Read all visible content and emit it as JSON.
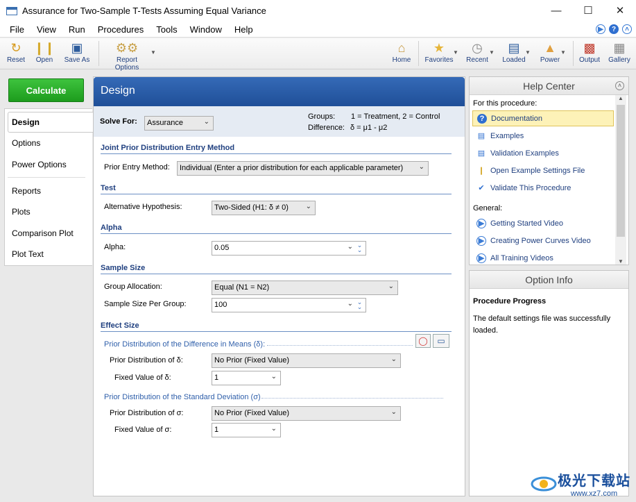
{
  "window": {
    "title": "Assurance for Two-Sample T-Tests Assuming Equal Variance"
  },
  "menu": [
    "File",
    "View",
    "Run",
    "Procedures",
    "Tools",
    "Window",
    "Help"
  ],
  "toolbar": {
    "reset": "Reset",
    "open": "Open",
    "save_as": "Save As",
    "report_options": "Report Options",
    "home": "Home",
    "favorites": "Favorites",
    "recent": "Recent",
    "loaded": "Loaded",
    "power": "Power",
    "output": "Output",
    "gallery": "Gallery"
  },
  "calculate": "Calculate",
  "tabs": [
    "Design",
    "Options",
    "Power Options",
    "Reports",
    "Plots",
    "Comparison Plot",
    "Plot Text"
  ],
  "design": {
    "header": "Design",
    "solve_for_label": "Solve For:",
    "solve_for_value": "Assurance",
    "groups_label": "Groups:",
    "groups_value": "1 = Treatment, 2 = Control",
    "difference_label": "Difference:",
    "difference_value": "δ = μ1 - μ2",
    "sec_joint": "Joint Prior Distribution Entry Method",
    "prior_entry_label": "Prior Entry Method:",
    "prior_entry_value": "Individual (Enter a prior distribution for each applicable parameter)",
    "sec_test": "Test",
    "alt_hyp_label": "Alternative Hypothesis:",
    "alt_hyp_value": "Two-Sided (H1: δ ≠ 0)",
    "sec_alpha": "Alpha",
    "alpha_label": "Alpha:",
    "alpha_value": "0.05",
    "sec_sample": "Sample Size",
    "group_alloc_label": "Group Allocation:",
    "group_alloc_value": "Equal (N1 = N2)",
    "ss_per_group_label": "Sample Size Per Group:",
    "ss_per_group_value": "100",
    "sec_effect": "Effect Size",
    "prior_diff_heading": "Prior Distribution of the Difference in Means (δ):",
    "prior_delta_label": "Prior Distribution of δ:",
    "prior_delta_value": "No Prior (Fixed Value)",
    "fixed_delta_label": "Fixed Value of δ:",
    "fixed_delta_value": "1",
    "prior_sd_heading": "Prior Distribution of the Standard Deviation (σ)",
    "prior_sigma_label": "Prior Distribution of σ:",
    "prior_sigma_value": "No Prior (Fixed Value)",
    "fixed_sigma_label": "Fixed Value of σ:",
    "fixed_sigma_value": "1"
  },
  "help_center": {
    "title": "Help Center",
    "for_this": "For this procedure:",
    "items": [
      "Documentation",
      "Examples",
      "Validation Examples",
      "Open Example Settings File",
      "Validate This Procedure"
    ],
    "general": "General:",
    "general_items": [
      "Getting Started Video",
      "Creating Power Curves Video",
      "All Training Videos"
    ]
  },
  "option_info": {
    "title": "Option Info",
    "heading": "Procedure Progress",
    "text": "The default settings file was successfully loaded."
  },
  "watermark": {
    "text": "极光下载站",
    "sub": "www.xz7.com"
  },
  "colors": {
    "accent": "#1f4f98",
    "calculate": "#22a322",
    "link": "#1f3f7f"
  }
}
